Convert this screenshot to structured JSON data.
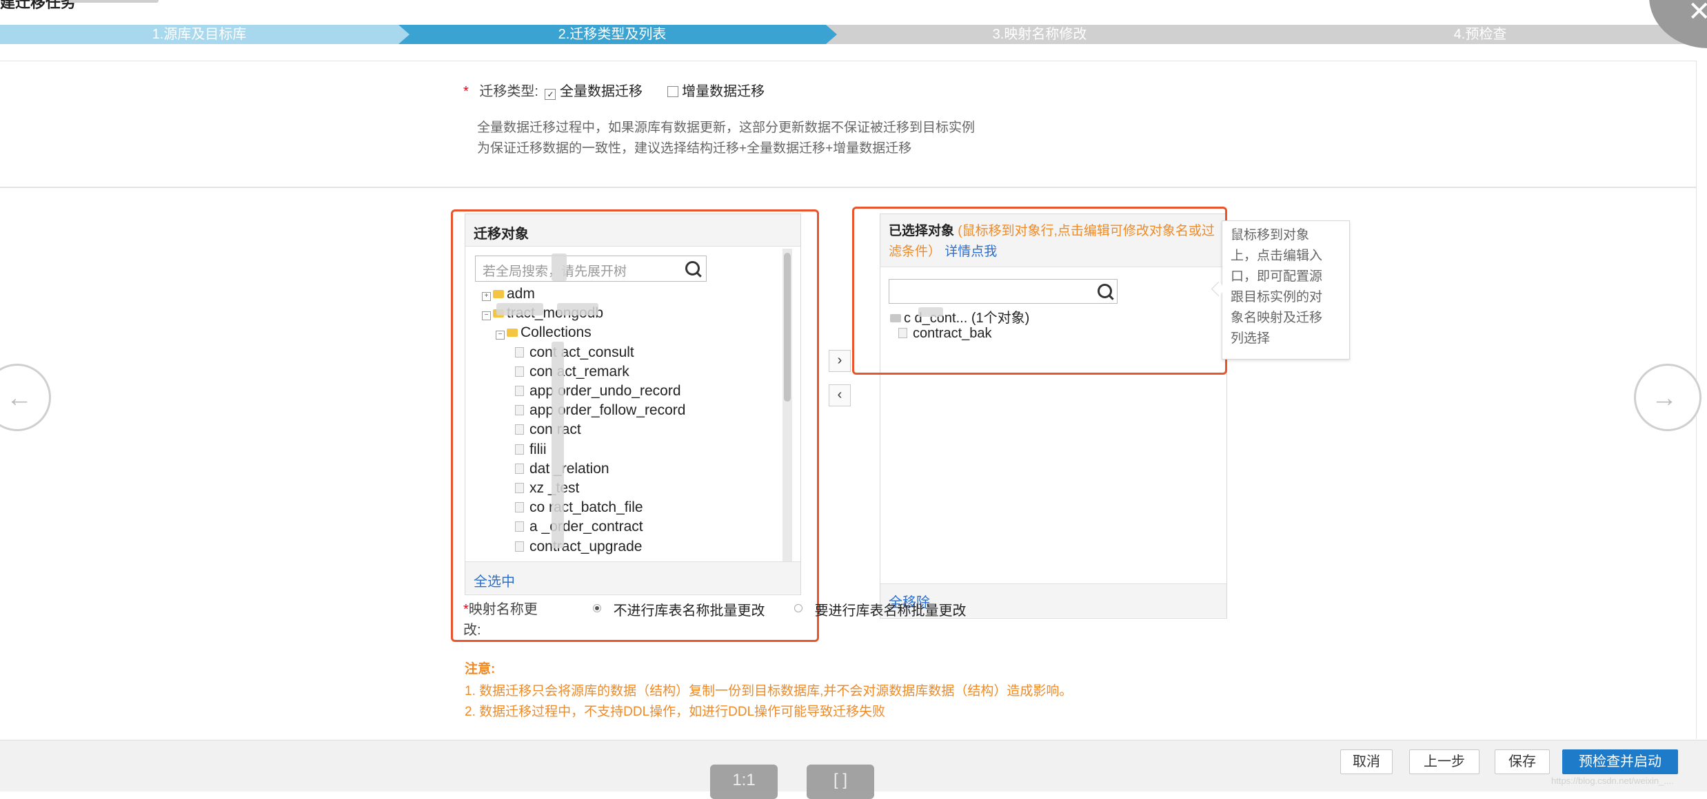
{
  "header": {
    "title": "建迁移任务",
    "close_glyph": "✕"
  },
  "steps": [
    {
      "label": "1.源库及目标库",
      "state": "done",
      "color": "#a8d8ee"
    },
    {
      "label": "2.迁移类型及列表",
      "state": "active",
      "color": "#3aa3d1"
    },
    {
      "label": "3.映射名称修改",
      "state": "todo",
      "color": "#d0d0d0"
    },
    {
      "label": "4.预检查",
      "state": "todo",
      "color": "#d0d0d0"
    }
  ],
  "migration_type": {
    "required_mark": "*",
    "label": "迁移类型:",
    "options": [
      {
        "label": "全量数据迁移",
        "checked": true
      },
      {
        "label": "增量数据迁移",
        "checked": false
      }
    ],
    "note_line1": "全量数据迁移过程中，如果源库有数据更新，这部分更新数据不保证被迁移到目标实例",
    "note_line2": "为保证迁移数据的一致性，建议选择结构迁移+全量数据迁移+增量数据迁移"
  },
  "source_panel": {
    "title": "迁移对象",
    "search_placeholder": "若全局搜索，请先展开树",
    "select_all": "全选中",
    "tree": [
      {
        "level": 0,
        "kind": "folder",
        "expander": "⊞",
        "label": "adm"
      },
      {
        "level": 0,
        "kind": "folder",
        "expander": "⊟",
        "label": "tract_mongodb"
      },
      {
        "level": 1,
        "kind": "folder",
        "expander": "⊟",
        "label": "Collections"
      },
      {
        "level": 2,
        "kind": "doc",
        "label": "cont act_consult"
      },
      {
        "level": 2,
        "kind": "doc",
        "label": "con act_remark"
      },
      {
        "level": 2,
        "kind": "doc",
        "label": "app order_undo_record"
      },
      {
        "level": 2,
        "kind": "doc",
        "label": "app order_follow_record"
      },
      {
        "level": 2,
        "kind": "doc",
        "label": "con ract"
      },
      {
        "level": 2,
        "kind": "doc",
        "label": "filii"
      },
      {
        "level": 2,
        "kind": "doc",
        "label": "dat _relation"
      },
      {
        "level": 2,
        "kind": "doc",
        "label": "xz _test"
      },
      {
        "level": 2,
        "kind": "doc",
        "label": "co ract_batch_file"
      },
      {
        "level": 2,
        "kind": "doc",
        "label": "a _order_contract"
      },
      {
        "level": 2,
        "kind": "doc",
        "label": "contract_upgrade"
      }
    ]
  },
  "transfer": {
    "add": "›",
    "remove": "‹"
  },
  "selected_panel": {
    "title": "已选择对象",
    "hint": "(鼠标移到对象行,点击编辑可修改对象名或过滤条件）",
    "details_link": "详情点我",
    "remove_all": "全移除",
    "tree": [
      {
        "label": "c  d_cont... (1个对象)",
        "kind": "folder"
      },
      {
        "label": "contract_bak",
        "kind": "doc"
      }
    ]
  },
  "tooltip": {
    "lines": [
      "鼠标移到对象",
      "上，点击编辑入",
      "口，即可配置源",
      "跟目标实例的对",
      "象名映射及迁移",
      "列选择"
    ]
  },
  "mapping": {
    "required_mark": "*",
    "label_line1": "映射名称更",
    "label_line2": "改:",
    "options": [
      {
        "label": "不进行库表名称批量更改",
        "selected": true
      },
      {
        "label": "要进行库表名称批量更改",
        "selected": false
      }
    ]
  },
  "notice": {
    "title": "注意:",
    "line1": "1. 数据迁移只会将源库的数据（结构）复制一份到目标数据库,并不会对源数据库数据（结构）造成影响。",
    "line2": "2. 数据迁移过程中，不支持DDL操作，如进行DDL操作可能导致迁移失败"
  },
  "nav": {
    "prev_glyph": "←",
    "next_glyph": "→"
  },
  "footer": {
    "cancel": "取消",
    "prev": "上一步",
    "save": "保存",
    "precheck_start": "预检查并启动"
  },
  "viewer": {
    "ratio_label": "1:1",
    "fit_label": "[  ]"
  },
  "watermark": "https://blog.csdn.net/weixin_...."
}
